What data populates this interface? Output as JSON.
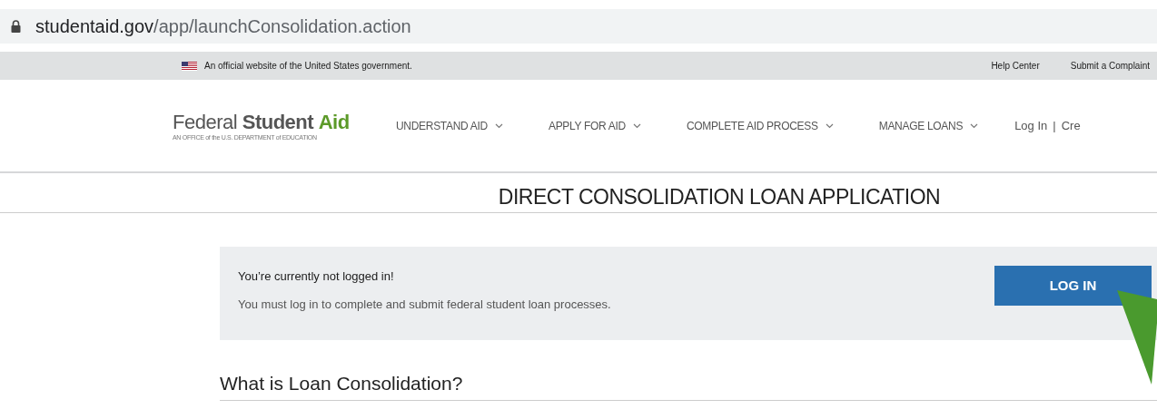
{
  "address_bar": {
    "domain": "studentaid.gov",
    "path": "/app/launchConsolidation.action"
  },
  "gov_banner": {
    "text": "An official website of the United States government.",
    "links": [
      "Help Center",
      "Submit a Complaint"
    ]
  },
  "header": {
    "logo": {
      "word_1": "Federal",
      "word_2": "Student",
      "word_3": "Aid",
      "tagline": "AN OFFICE of the U.S. DEPARTMENT of EDUCATION"
    },
    "nav": [
      {
        "label": "UNDERSTAND AID"
      },
      {
        "label": "APPLY FOR AID"
      },
      {
        "label": "COMPLETE AID PROCESS"
      },
      {
        "label": "MANAGE LOANS"
      }
    ],
    "account_links": [
      {
        "label": "Log In"
      },
      {
        "separator": "|",
        "label": "Cre"
      }
    ]
  },
  "page_title": "DIRECT CONSOLIDATION LOAN APPLICATION",
  "alert": {
    "title": "You’re currently not logged in!",
    "message": "You must log in to complete and submit federal student loan processes.",
    "button": "LOG IN"
  },
  "section_heading": "What is Loan Consolidation?"
}
